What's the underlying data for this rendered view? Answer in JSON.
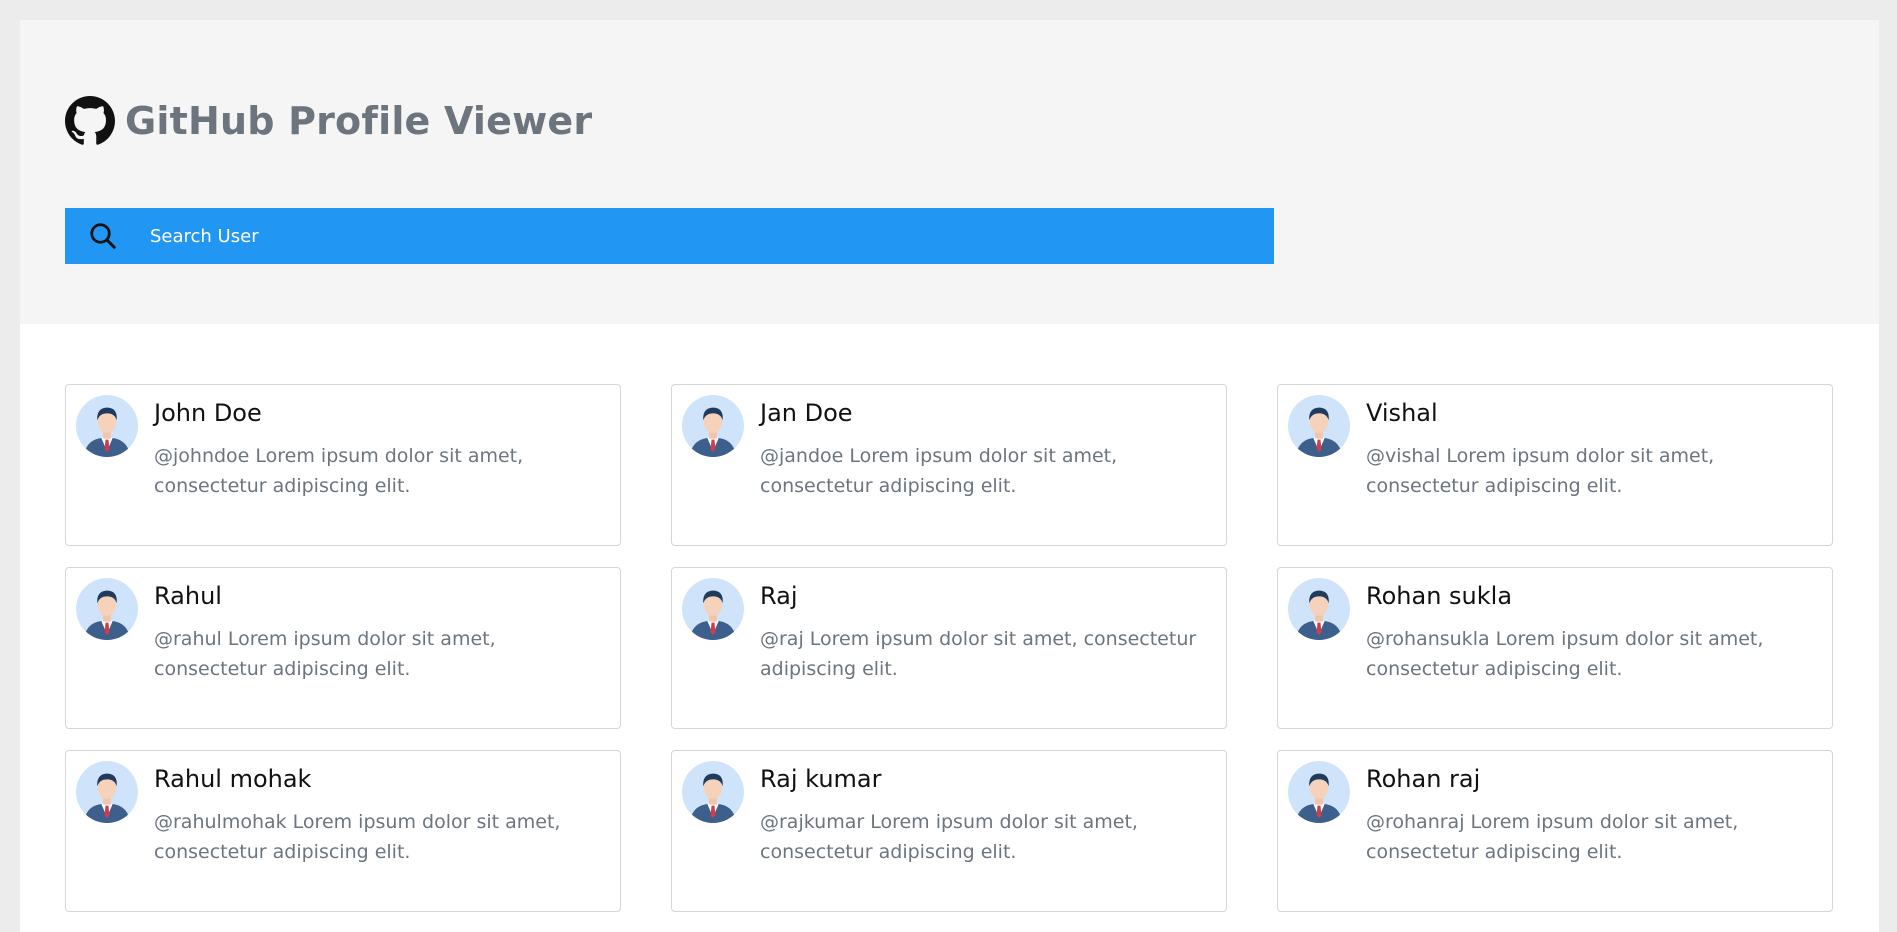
{
  "app": {
    "title": "GitHub Profile Viewer",
    "logo_icon": "github-icon"
  },
  "search": {
    "icon": "search-icon",
    "placeholder": "Search User",
    "value": ""
  },
  "colors": {
    "accent": "#2196f3",
    "header_bg": "#f5f5f5",
    "muted_text": "#6c757d"
  },
  "users": [
    {
      "name": "John Doe",
      "bio": "@johndoe Lorem ipsum dolor sit amet, consectetur adipiscing elit."
    },
    {
      "name": "Jan Doe",
      "bio": "@jandoe Lorem ipsum dolor sit amet, consectetur adipiscing elit."
    },
    {
      "name": "Vishal",
      "bio": "@vishal Lorem ipsum dolor sit amet, consectetur adipiscing elit."
    },
    {
      "name": "Rahul",
      "bio": "@rahul Lorem ipsum dolor sit amet, consectetur adipiscing elit."
    },
    {
      "name": "Raj",
      "bio": "@raj Lorem ipsum dolor sit amet, consectetur adipiscing elit."
    },
    {
      "name": "Rohan sukla",
      "bio": "@rohansukla Lorem ipsum dolor sit amet, consectetur adipiscing elit."
    },
    {
      "name": "Rahul mohak",
      "bio": "@rahulmohak Lorem ipsum dolor sit amet, consectetur adipiscing elit."
    },
    {
      "name": "Raj kumar",
      "bio": "@rajkumar Lorem ipsum dolor sit amet, consectetur adipiscing elit."
    },
    {
      "name": "Rohan raj",
      "bio": "@rohanraj Lorem ipsum dolor sit amet, consectetur adipiscing elit."
    }
  ]
}
